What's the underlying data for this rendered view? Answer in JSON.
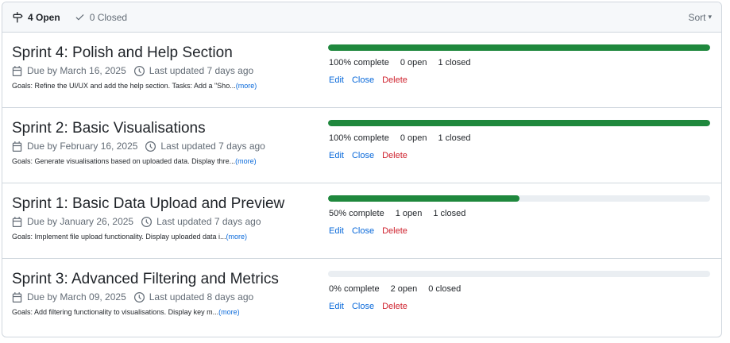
{
  "header": {
    "open_label": "4 Open",
    "closed_label": "0 Closed",
    "sort_label": "Sort"
  },
  "milestones": [
    {
      "title": "Sprint 4: Polish and Help Section",
      "due": "Due by March 16, 2025",
      "updated": "Last updated 7 days ago",
      "goals": "Goals: Refine the UI/UX and add the help section. Tasks: Add a \"Sho...",
      "more": "(more)",
      "progress": 1.0,
      "complete": "100% complete",
      "open": "0 open",
      "closed": "1 closed",
      "edit": "Edit",
      "close": "Close",
      "delete": "Delete"
    },
    {
      "title": "Sprint 2: Basic Visualisations",
      "due": "Due by February 16, 2025",
      "updated": "Last updated 7 days ago",
      "goals": "Goals: Generate visualisations based on uploaded data. Display thre...",
      "more": "(more)",
      "progress": 1.0,
      "complete": "100% complete",
      "open": "0 open",
      "closed": "1 closed",
      "edit": "Edit",
      "close": "Close",
      "delete": "Delete"
    },
    {
      "title": "Sprint 1: Basic Data Upload and Preview",
      "due": "Due by January 26, 2025",
      "updated": "Last updated 7 days ago",
      "goals": "Goals: Implement file upload functionality. Display uploaded data i...",
      "more": "(more)",
      "progress": 0.5,
      "complete": "50% complete",
      "open": "1 open",
      "closed": "1 closed",
      "edit": "Edit",
      "close": "Close",
      "delete": "Delete"
    },
    {
      "title": "Sprint 3: Advanced Filtering and Metrics",
      "due": "Due by March 09, 2025",
      "updated": "Last updated 8 days ago",
      "goals": "Goals: Add filtering functionality to visualisations. Display key m...",
      "more": "(more)",
      "progress": 0.0,
      "complete": "0% complete",
      "open": "2 open",
      "closed": "0 closed",
      "edit": "Edit",
      "close": "Close",
      "delete": "Delete"
    }
  ],
  "colors": {
    "progress_fill": "#1f883d",
    "progress_track": "#eaeef2",
    "link": "#0969da",
    "danger": "#cf222e"
  }
}
